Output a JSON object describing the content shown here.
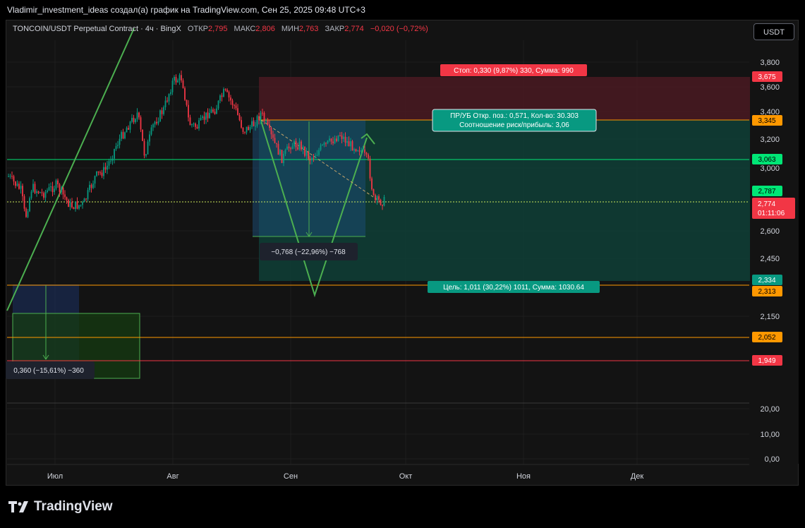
{
  "header": {
    "author_line": "Vladimir_investment_ideas создал(а) график на TradingView.com, Сен 25, 2025 09:48 UTC+3"
  },
  "legend": {
    "symbol": "TONCOIN/USDT Perpetual Contract · 4ч · BingX",
    "open_label": "ОТКР",
    "open_value": "2,795",
    "high_label": "МАКС",
    "high_value": "2,806",
    "low_label": "МИН",
    "low_value": "2,763",
    "close_label": "ЗАКР",
    "close_value": "2,774",
    "change": "−0,020 (−0,72%)"
  },
  "currency_button": "USDT",
  "price_axis": {
    "ticks": [
      "3,800",
      "3,600",
      "3,400",
      "3,200",
      "3,000",
      "2,600",
      "2,450",
      "2,150"
    ],
    "tags": [
      {
        "text": "3,675",
        "color": "#f23645"
      },
      {
        "text": "3,345",
        "color": "#ff9800"
      },
      {
        "text": "3,063",
        "color": "#00e676"
      },
      {
        "text": "2,787",
        "color": "#00e676"
      },
      {
        "text": "2,774",
        "color": "#f23645"
      },
      {
        "text": "01:11:06",
        "color": "#f23645"
      },
      {
        "text": "2,334",
        "color": "#089981"
      },
      {
        "text": "2,313",
        "color": "#ff9800"
      },
      {
        "text": "2,052",
        "color": "#ff9800"
      },
      {
        "text": "1,949",
        "color": "#f23645"
      }
    ]
  },
  "indicator_axis": {
    "ticks": [
      "20,00",
      "10,00",
      "0,00"
    ]
  },
  "time_axis": {
    "labels": [
      "Июл",
      "Авг",
      "Сен",
      "Окт",
      "Ноя",
      "Дек"
    ]
  },
  "annotations": {
    "stop": "Стоп: 0,330 (9,87%) 330, Сумма: 990",
    "pnl_line1": "ПР/УБ Откр. поз.: 0,571, Кол-во: 30.303",
    "pnl_line2": "Соотношение риск/прибыль: 3,06",
    "target": "Цель: 1,011 (30,22%) 1011, Сумма: 1030.64",
    "range_mid": "−0,768 (−22,96%) −768",
    "range_left": "0,360 (−15,61%) −360"
  },
  "brand": "TradingView",
  "colors": {
    "bull": "#089981",
    "bear": "#f23645",
    "bg": "#131313",
    "green_line": "#4caf50",
    "orange_line": "#ff9800"
  }
}
